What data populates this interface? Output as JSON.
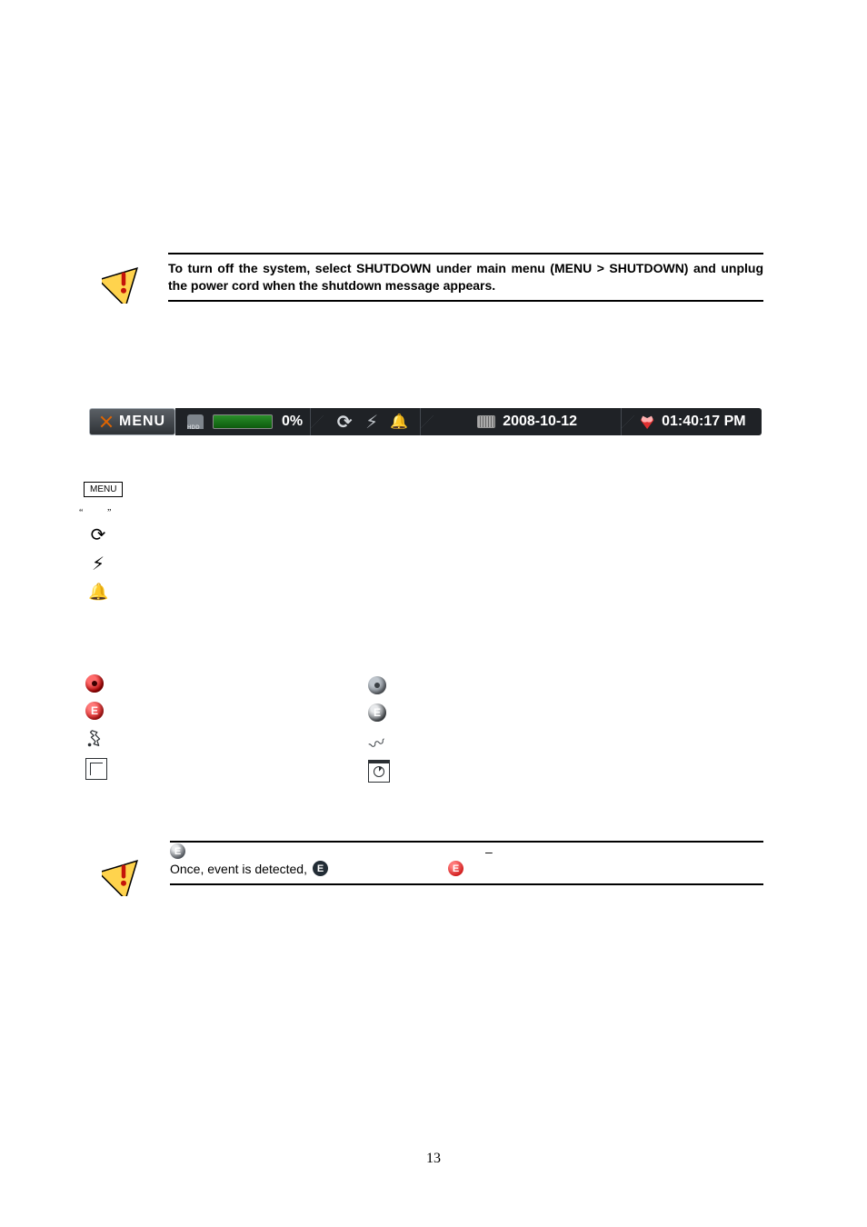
{
  "shutdown_note": "To turn off the system, select SHUTDOWN under main menu (MENU > SHUTDOWN) and unplug the power cord when the shutdown message appears.",
  "osd_bar": {
    "menu_label": "MENU",
    "hdd_percent": "0%",
    "date": "2008-10-12",
    "time": "01:40:17 PM"
  },
  "small_menu_label": "MENU",
  "bottom_note": {
    "line1_suffix": "–",
    "line2_prefix": "Once, event is detected,"
  },
  "page_number": "13",
  "glyphs": {
    "sequence": "⟳",
    "network": "⚡",
    "alarm": "🔔",
    "e": "E"
  }
}
